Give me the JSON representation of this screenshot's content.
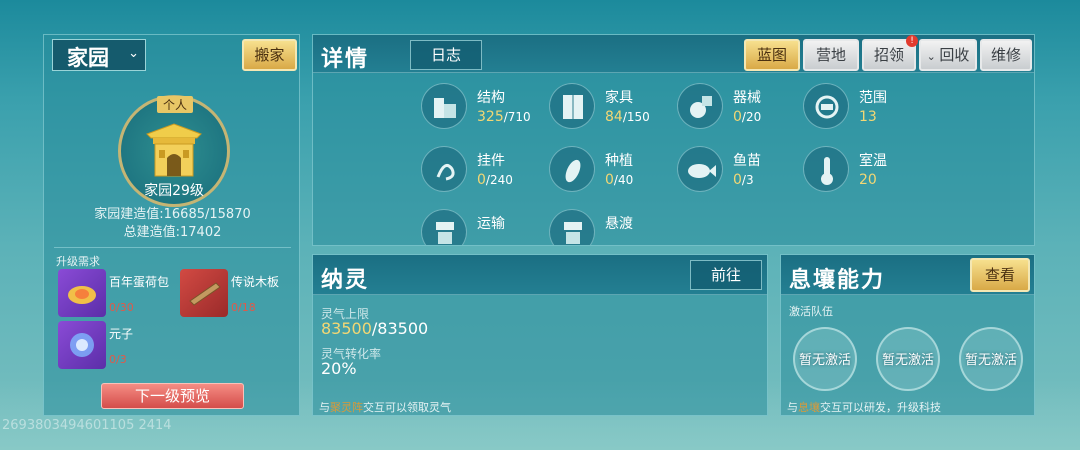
{
  "left_panel": {
    "dropdown_label": "家园",
    "move_button": "搬家",
    "emblem_tag": "个人",
    "level_label": "家园29级",
    "build_label": "家园建造值:",
    "build_value": "16685/15870",
    "total_label": "总建造值:",
    "total_value": "17402",
    "upgrade_title": "升级需求",
    "requirements": [
      {
        "name": "百年蛋荷包",
        "count": "0/30",
        "icon": "lotus-egg-icon"
      },
      {
        "name": "传说木板",
        "count": "0/18",
        "icon": "wood-plank-icon"
      },
      {
        "name": "元子",
        "count": "0/3",
        "icon": "yuanzi-icon"
      }
    ],
    "preview_button": "下一级预览"
  },
  "details": {
    "title": "详情",
    "log_button": "日志",
    "buttons": {
      "blueprint": "蓝图",
      "camp": "营地",
      "recruit": "招领",
      "recycle": "回收",
      "repair": "维修"
    },
    "stats": [
      {
        "name": "结构",
        "value": "325",
        "max": "/710",
        "icon": "structure-icon"
      },
      {
        "name": "家具",
        "value": "84",
        "max": "/150",
        "icon": "furniture-icon"
      },
      {
        "name": "器械",
        "value": "0",
        "max": "/20",
        "icon": "machine-icon"
      },
      {
        "name": "范围",
        "value": "13",
        "max": "",
        "icon": "range-icon"
      },
      {
        "name": "挂件",
        "value": "0",
        "max": "/240",
        "icon": "pendant-icon"
      },
      {
        "name": "种植",
        "value": "0",
        "max": "/40",
        "icon": "planting-icon"
      },
      {
        "name": "鱼苗",
        "value": "0",
        "max": "/3",
        "icon": "fish-icon"
      },
      {
        "name": "室温",
        "value": "20",
        "max": "",
        "icon": "thermometer-icon"
      },
      {
        "name": "运输",
        "value": "",
        "max": "",
        "icon": "transport-icon"
      },
      {
        "name": "悬渡",
        "value": "",
        "max": "",
        "icon": "suspension-icon"
      }
    ]
  },
  "naling": {
    "title": "纳灵",
    "go_button": "前往",
    "cap_label": "灵气上限",
    "cap_current": "83500",
    "cap_max": "/83500",
    "rate_label": "灵气转化率",
    "rate_value": "20%",
    "footer_pre": "与",
    "footer_hl": "聚灵阵",
    "footer_post": "交互可以领取灵气"
  },
  "xirang": {
    "title": "息壤能力",
    "view_button": "查看",
    "team_label": "激活队伍",
    "slots": [
      "暂无激活",
      "暂无激活",
      "暂无激活"
    ],
    "footer_pre": "与",
    "footer_hl": "息壤",
    "footer_post": "交互可以研发，升级科技"
  },
  "watermark": "2693803494601105 2414"
}
